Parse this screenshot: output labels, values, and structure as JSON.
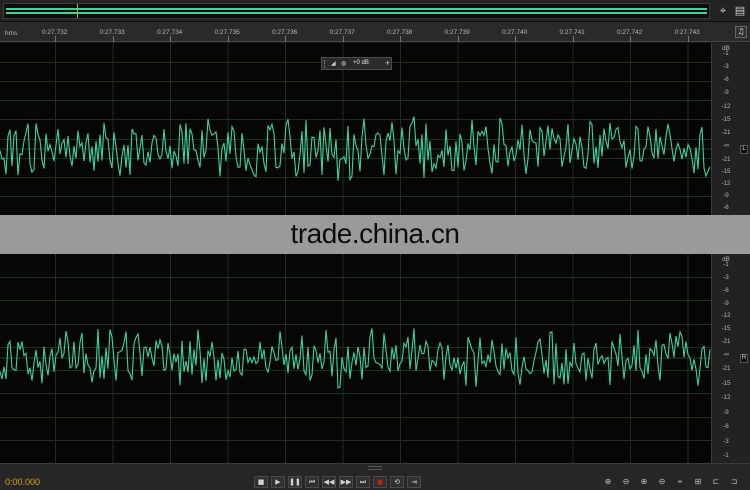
{
  "ruler": {
    "unit_label": "hms",
    "labels": [
      "0:27.732",
      "0:27.733",
      "0:27.734",
      "0:27.735",
      "0:27.736",
      "0:27.737",
      "0:27.738",
      "0:27.739",
      "0:27.740",
      "0:27.741",
      "0:27.742",
      "0:27.743"
    ]
  },
  "db_scale": {
    "unit": "dB",
    "top_half": [
      "-1",
      "-3",
      "-6",
      "-9",
      "-12",
      "-15",
      "-21",
      "-∞"
    ],
    "bottom_half": [
      "-21",
      "-15",
      "-12",
      "-9",
      "-6",
      "-3",
      "-1"
    ],
    "left_channel_bottom_visible": [
      "-21",
      "-15",
      "-12",
      "-9",
      "-6"
    ]
  },
  "channels": {
    "left_label": "L",
    "right_label": "R"
  },
  "hud": {
    "db_value": "+0 dB"
  },
  "watermark": "trade.china.cn",
  "transport": {
    "time": "0:00.000"
  },
  "colors": {
    "waveform": "#3fd39a",
    "playhead": "#d4a23a",
    "time_display": "#d7a21f",
    "record": "#c02222"
  },
  "icons": {
    "overview_zoom": "zoom-crosshair-icon",
    "overview_panel": "panel-toggle-icon",
    "monitor": "headphones-icon",
    "transport": [
      "stop-icon",
      "play-icon",
      "pause-icon",
      "go-to-start-icon",
      "rewind-icon",
      "fast-forward-icon",
      "go-to-end-icon",
      "record-icon",
      "loop-icon",
      "skip-selection-icon"
    ],
    "zoom": [
      "zoom-in-amplitude-icon",
      "zoom-out-amplitude-icon",
      "zoom-in-time-icon",
      "zoom-out-time-icon",
      "zoom-full-icon",
      "zoom-selection-icon",
      "zoom-in-left-icon",
      "zoom-in-right-icon"
    ]
  }
}
